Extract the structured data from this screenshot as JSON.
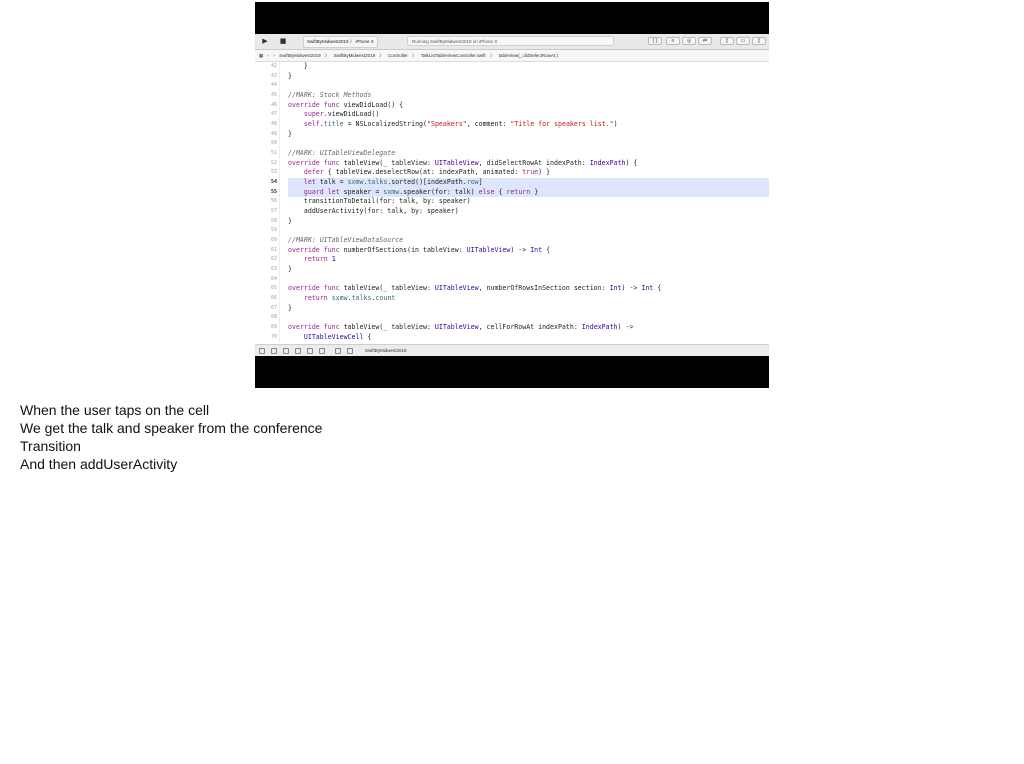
{
  "toolbar": {
    "scheme": "SwiftByMidwest2019 〉 iPhone X",
    "status": "Running SwiftByMidwest2019 on iPhone X"
  },
  "jumpbar": {
    "items": [
      "SwiftByMidwest2019",
      "〉",
      "SwiftByMidwest2019",
      "〉",
      "Controller",
      "〉",
      "TalkListTableViewController.swift",
      "〉",
      "tableView(_:didSelectRowAt:)"
    ]
  },
  "editor": {
    "line_numbers": [
      "42",
      "43",
      "44",
      "45",
      "46",
      "47",
      "48",
      "49",
      "50",
      "51",
      "52",
      "53",
      "54",
      "55",
      "56",
      "57",
      "58",
      "59",
      "60",
      "61",
      "62",
      "63",
      "64",
      "65",
      "66",
      "67",
      "68",
      "69",
      "70"
    ],
    "highlighted_lines": [
      "54",
      "55"
    ]
  },
  "debug": {
    "target": "SwiftByMidwest2019"
  },
  "notes": [
    "When the user taps on the cell",
    "We get the talk and speaker from the conference",
    "Transition",
    "And then addUserActivity"
  ]
}
